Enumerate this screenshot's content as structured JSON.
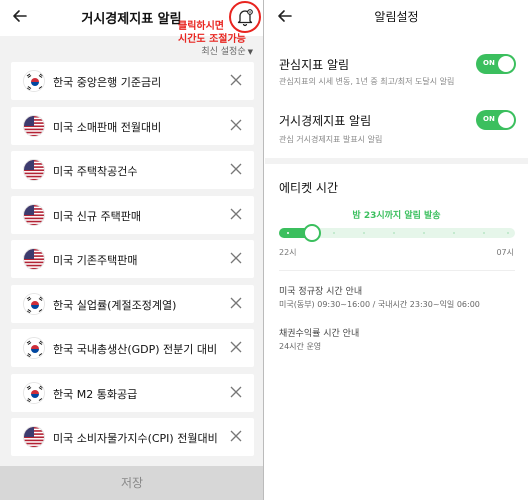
{
  "left": {
    "title": "거시경제지표 알림",
    "annotation_line1": "클릭하시면",
    "annotation_line2": "시간도 조절가능",
    "sort_label": "최신 설정순",
    "items": [
      {
        "flag": "KR",
        "label": "한국 중앙은행 기준금리"
      },
      {
        "flag": "US",
        "label": "미국 소매판매 전월대비"
      },
      {
        "flag": "US",
        "label": "미국 주택착공건수"
      },
      {
        "flag": "US",
        "label": "미국 신규 주택판매"
      },
      {
        "flag": "US",
        "label": "미국 기존주택판매"
      },
      {
        "flag": "KR",
        "label": "한국 실업률(계절조정계열)"
      },
      {
        "flag": "KR",
        "label": "한국 국내총생산(GDP) 전분기 대비"
      },
      {
        "flag": "KR",
        "label": "한국 M2 통화공급"
      },
      {
        "flag": "US",
        "label": "미국 소비자물가지수(CPI) 전월대비"
      }
    ],
    "save_label": "저장"
  },
  "right": {
    "title": "알림설정",
    "interest": {
      "title": "관심지표 알림",
      "sub": "관심지표의 시세 변동, 1년 중 최고/최저 도달시 알림",
      "toggle": "ON"
    },
    "macro": {
      "title": "거시경제지표 알림",
      "sub": "관심 거시경제지표 발표시 알림",
      "toggle": "ON"
    },
    "etiquette": {
      "title": "에티켓 시간",
      "message_bold": "밤 23시",
      "message_rest": "까지 알림 발송",
      "start_label": "22시",
      "end_label": "07시"
    },
    "us_market": {
      "title": "미국 정규장 시간 안내",
      "text": "미국(동부) 09:30~16:00 / 국내시간 23:30~익일 06:00"
    },
    "bond": {
      "title": "채권수익률 시간 안내",
      "text": "24시간 운영"
    }
  },
  "colors": {
    "accent": "#3bbf5e",
    "annotation": "#e8241f"
  }
}
